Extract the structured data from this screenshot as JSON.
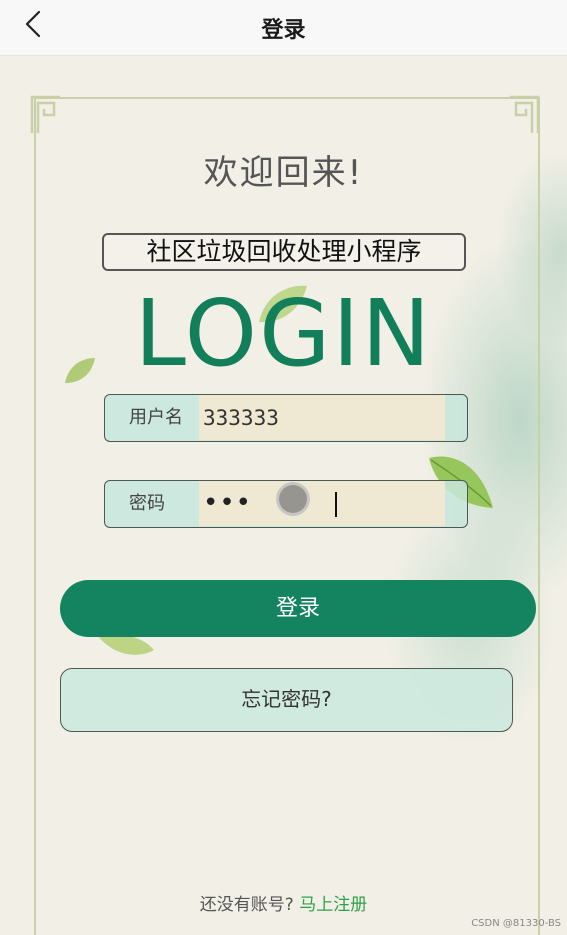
{
  "navbar": {
    "title": "登录",
    "back_icon": "chevron-left-icon"
  },
  "main": {
    "welcome": "欢迎回来!",
    "app_name": "社区垃圾回收处理小程序",
    "login_heading": "LOGIN"
  },
  "form": {
    "username": {
      "label": "用户名",
      "value": "333333"
    },
    "password": {
      "label": "密码",
      "masked_value": "•••"
    }
  },
  "buttons": {
    "login_label": "登录",
    "forgot_label": "忘记密码?"
  },
  "register": {
    "hint": "还没有账号?",
    "link": "马上注册"
  },
  "watermark": "CSDN @81330-BS",
  "colors": {
    "primary_green": "#13845f",
    "link_green": "#2ea24a",
    "field_bg": "#c7e6dc",
    "input_bg": "#efe9d3"
  }
}
